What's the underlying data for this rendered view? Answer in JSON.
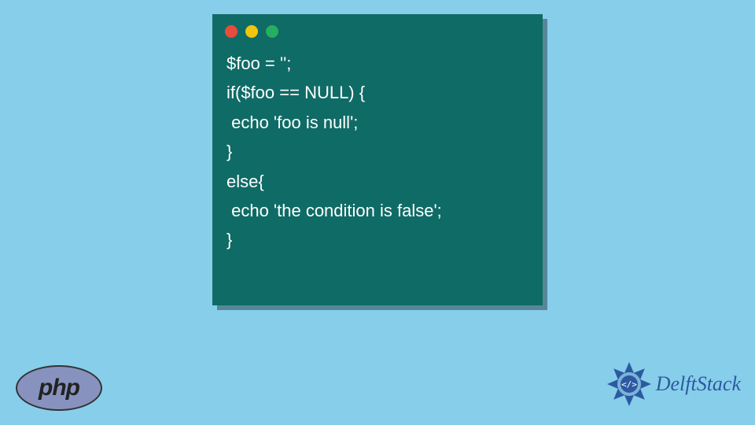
{
  "code": {
    "line1": "$foo = '';",
    "line2": "if($foo == NULL) {",
    "line3": " echo 'foo is null';",
    "line4": "}",
    "line5": "else{",
    "line6": " echo 'the condition is false';",
    "line7": "}"
  },
  "badges": {
    "php": "php",
    "delft": "DelftStack"
  }
}
